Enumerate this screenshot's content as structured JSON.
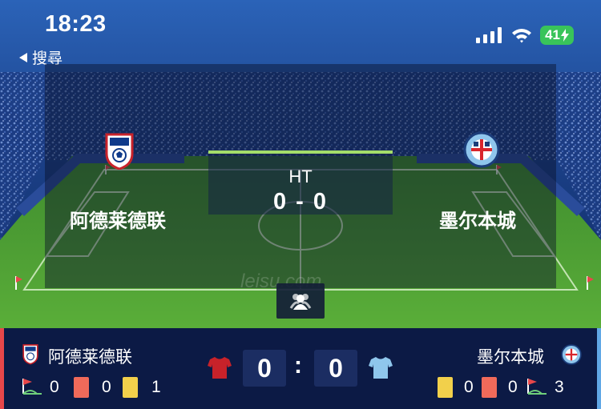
{
  "status_bar": {
    "time": "18:23",
    "back_label": "搜尋",
    "battery": "41"
  },
  "match": {
    "status": "HT",
    "score_display": "0 - 0",
    "home": {
      "name": "阿德莱德联",
      "logo_text": "ADELAIDE UNITED F.C.",
      "score": "0",
      "corners": "0",
      "red_cards": "0",
      "yellow_cards": "1",
      "kit_color": "#c8222a"
    },
    "away": {
      "name": "墨尔本城",
      "score": "0",
      "corners": "3",
      "red_cards": "0",
      "yellow_cards": "0",
      "kit_color": "#8fc6ec"
    },
    "score_separator": ":"
  },
  "watermark": "leisu.com",
  "colors": {
    "accent_green": "#a4dd6a",
    "home_accent": "#e8474a",
    "away_accent": "#61a8e6"
  }
}
